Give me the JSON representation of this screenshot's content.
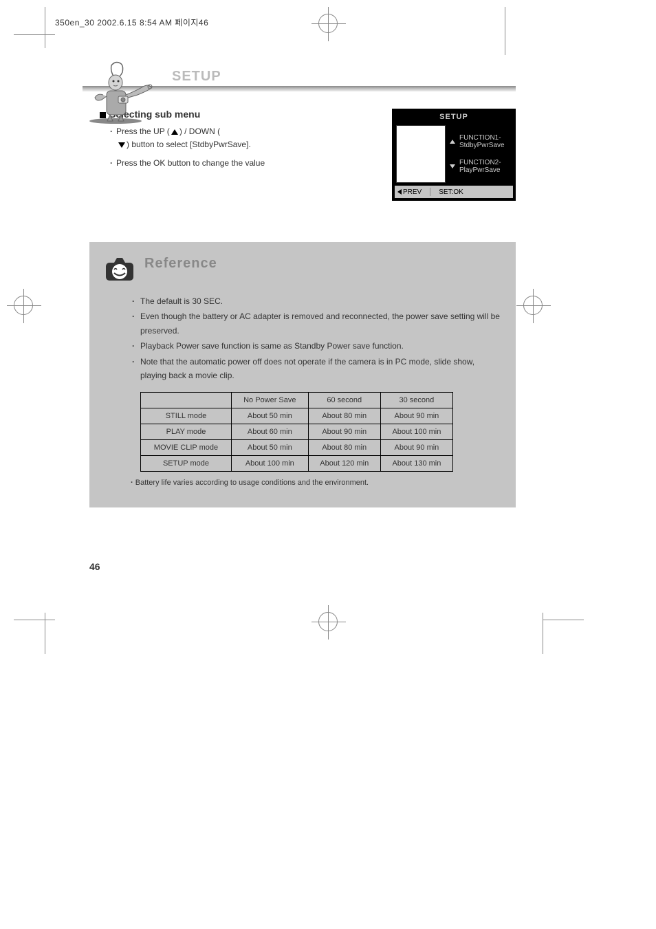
{
  "header_text": "350en_30  2002.6.15 8:54 AM  페이지46",
  "section_title": "SETUP",
  "main": {
    "heading": "Selecting sub menu",
    "step1_prefix": "Press the UP (",
    "step1_mid": ") / DOWN (",
    "step1_suffix": ") button to select [StdbyPwrSave].",
    "step2": "Press the OK button to change the value"
  },
  "lcd": {
    "title": "SETUP",
    "function1": "FUNCTION1-",
    "function2": "FUNCTION2-",
    "func1_label": "StdbyPwrSave",
    "func2_label": "PlayPwrSave",
    "footer_prev": "PREV",
    "footer_set": "SET:OK"
  },
  "reference": {
    "title": "Reference",
    "items": [
      "The default is 30 SEC.",
      "Even though the battery or AC adapter is removed and reconnected, the power save setting will be preserved.",
      "Playback Power save function is same as Standby Power save function.",
      "Note that the automatic power off does not operate if the camera is in PC mode, slide show, playing back a movie clip."
    ],
    "caption": "Battery life varies according to usage conditions and the environment."
  },
  "table": {
    "headers": [
      "",
      "No Power Save",
      "60 second",
      "30 second"
    ],
    "rows": [
      {
        "label": "STILL mode",
        "c1": "About 50 min",
        "c2": "About 80 min",
        "c3": "About 90 min"
      },
      {
        "label": "PLAY mode",
        "c1": "About 60 min",
        "c2": "About 90 min",
        "c3": "About 100 min"
      },
      {
        "label": "MOVIE CLIP mode",
        "c1": "About 50 min",
        "c2": "About 80 min",
        "c3": "About 90 min"
      },
      {
        "label": "SETUP mode",
        "c1": "About 100 min",
        "c2": "About 120 min",
        "c3": "About 130 min"
      }
    ]
  },
  "page_number": "46"
}
